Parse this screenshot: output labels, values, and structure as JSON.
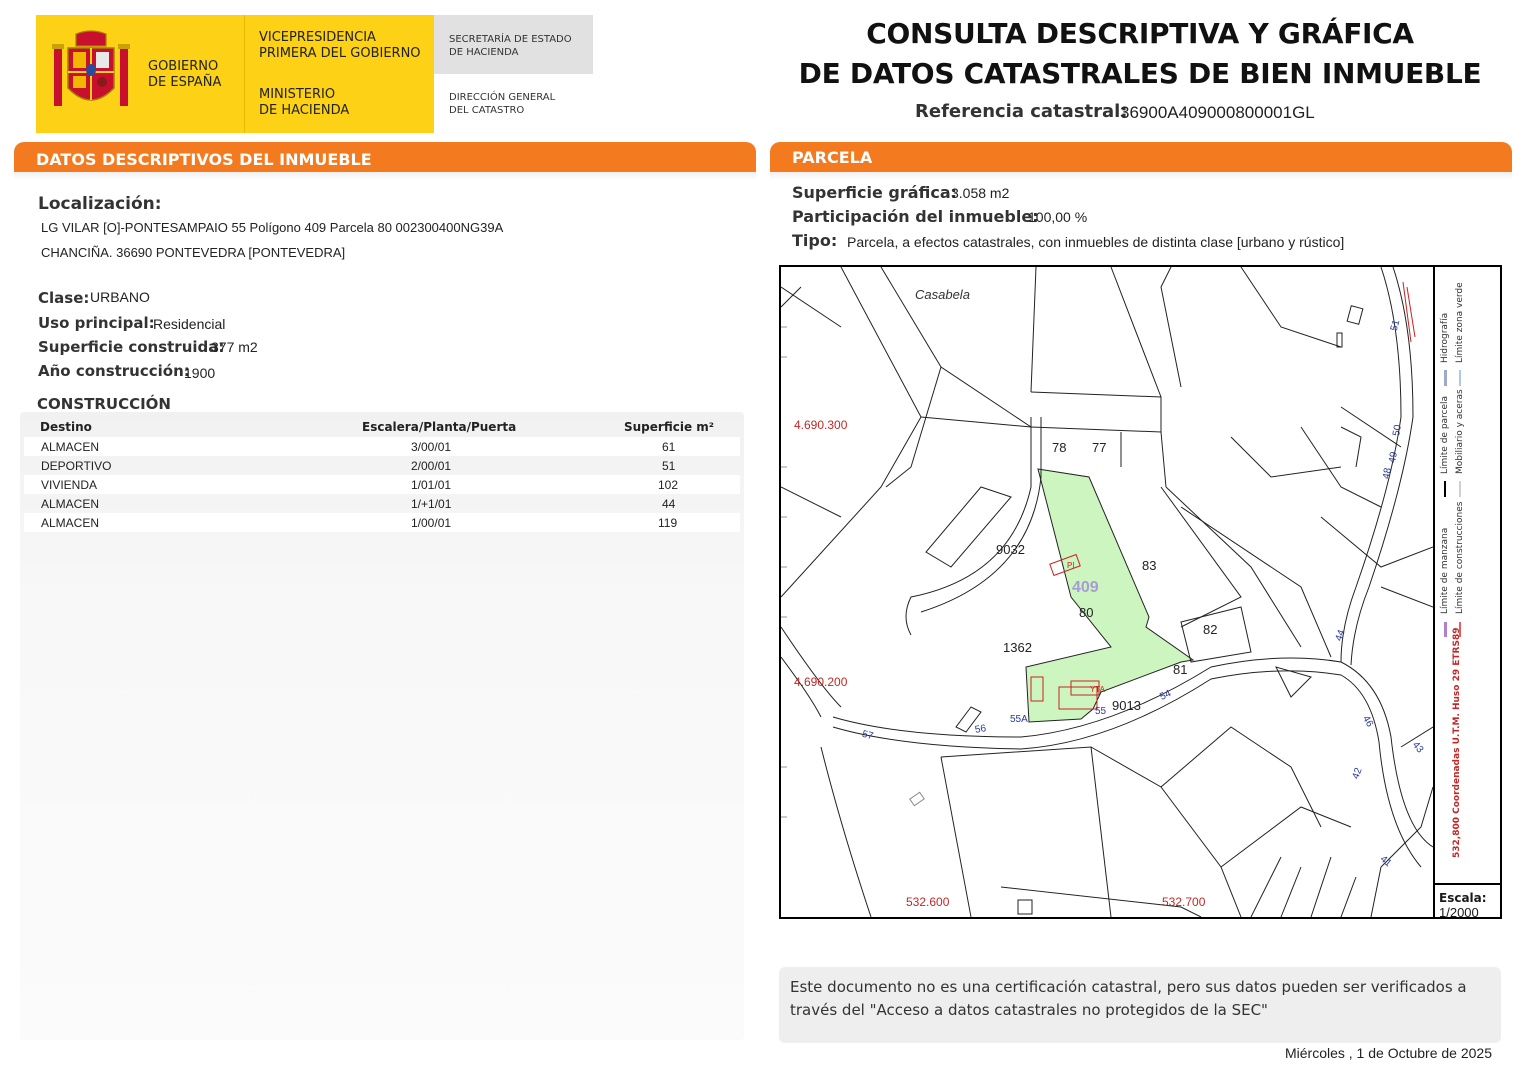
{
  "header": {
    "gov_name": "GOBIERNO\nDE ESPAÑA",
    "vice": "VICEPRESIDENCIA\nPRIMERA DEL GOBIERNO",
    "ministry": "MINISTERIO\nDE HACIENDA",
    "secretaria": "SECRETARÍA DE ESTADO\nDE HACIENDA",
    "direccion": "DIRECCIÓN GENERAL\nDEL CATASTRO",
    "title": "CONSULTA DESCRIPTIVA Y GRÁFICA\nDE DATOS CATASTRALES DE BIEN INMUEBLE",
    "ref_label": "Referencia catastral:",
    "ref_value": "36900A409000800001GL"
  },
  "left": {
    "section_title": "DATOS DESCRIPTIVOS DEL INMUEBLE",
    "loc_label": "Localización:",
    "loc_line1": "LG VILAR [O]-PONTESAMPAIO 55 Polígono 409 Parcela 80 002300400NG39A",
    "loc_line2": "CHANCIÑA. 36690 PONTEVEDRA [PONTEVEDRA]",
    "clase_label": "Clase:",
    "clase_value": "URBANO",
    "uso_label": "Uso principal:",
    "uso_value": "Residencial",
    "sup_label": "Superficie construida:",
    "sup_value": "377 m2",
    "anio_label": "Año construcción:",
    "anio_value": "1900",
    "construccion_title": "CONSTRUCCIÓN",
    "table": {
      "headers": [
        "Destino",
        "Escalera/Planta/Puerta",
        "Superficie m²"
      ],
      "rows": [
        [
          "ALMACEN",
          "3/00/01",
          "61"
        ],
        [
          "DEPORTIVO",
          "2/00/01",
          "51"
        ],
        [
          "VIVIENDA",
          "1/01/01",
          "102"
        ],
        [
          "ALMACEN",
          "1/+1/01",
          "44"
        ],
        [
          "ALMACEN",
          "1/00/01",
          "119"
        ]
      ]
    }
  },
  "right": {
    "section_title": "PARCELA",
    "sup_label": "Superficie gráfica:",
    "sup_value": "3.058 m2",
    "part_label": "Participación del inmueble:",
    "part_value": "100,00 %",
    "tipo_label": "Tipo:",
    "tipo_value": "Parcela, a efectos catastrales, con inmuebles de distinta clase [urbano y rústico]",
    "map": {
      "place": "Casabela",
      "coord_y1": "4.690.300",
      "coord_y2": "4.690.200",
      "coord_x1": "532.600",
      "coord_x2": "532.700",
      "poligono": "409",
      "parcels": [
        "78",
        "77",
        "9032",
        "83",
        "80",
        "82",
        "1362",
        "81",
        "9013"
      ],
      "road_numbers": [
        "57",
        "56",
        "55A",
        "55",
        "54",
        "51",
        "50",
        "49",
        "48",
        "44",
        "46",
        "43",
        "42",
        "41"
      ],
      "building_labels": [
        "PI",
        "YTA"
      ]
    },
    "legend": {
      "limite_manzana": "Límite de manzana",
      "limite_parcela": "Límite de parcela",
      "hidrografia": "Hidrografía",
      "limite_construcciones": "Límite de construcciones",
      "mobiliario": "Mobiliario y aceras",
      "zona_verde": "Límite zona verde",
      "coords": "532,800 Coordenadas U.T.M. Huso 29 ETRS89",
      "scale_label": "Escala:",
      "scale_value": "1/2000"
    },
    "note": "Este documento no es una certificación catastral, pero sus datos pueden ser verificados a través del \"Acceso a datos catastrales no protegidos de la SEC\"",
    "date": "Miércoles , 1 de Octubre de 2025"
  },
  "colors": {
    "orange": "#f47a20",
    "gov_yellow": "#fcd116",
    "parcel_green": "#ccf5c0"
  }
}
